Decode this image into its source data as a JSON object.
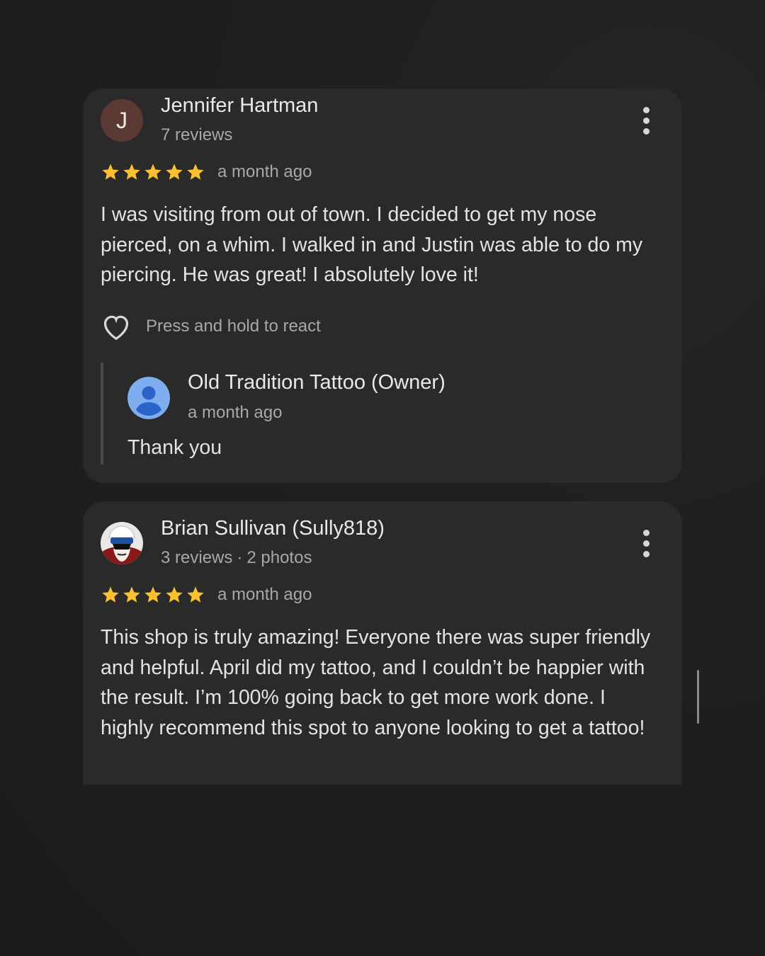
{
  "reviews": [
    {
      "author": "Jennifer Hartman",
      "avatar_letter": "J",
      "stats": "7 reviews",
      "rating": 5,
      "time": "a month ago",
      "text": "I was visiting from out of town. I decided to get my nose pierced, on a whim. I walked in and Justin was able to do my piercing. He was great! I absolutely love it!",
      "react_label": "Press and hold to react",
      "owner_reply": {
        "name": "Old Tradition Tattoo (Owner)",
        "time": "a month ago",
        "text": "Thank you"
      }
    },
    {
      "author": "Brian Sullivan (Sully818)",
      "stats_reviews": "3 reviews",
      "stats_separator": "·",
      "stats_photos": "2 photos",
      "rating": 5,
      "time": "a month ago",
      "text": "This shop is truly amazing! Everyone there was super friendly and helpful. April did my tattoo, and I couldn’t be happier with the result. I’m 100% going back to get more work done. I highly recommend this spot to anyone looking to get a tattoo!"
    }
  ],
  "icons": {
    "star": "star-icon",
    "more": "more-vert-icon",
    "heart": "heart-outline-icon",
    "owner_avatar": "default-profile-icon"
  },
  "colors": {
    "star": "#fbc02d",
    "card_bg": "#2a2a2b",
    "page_bg": "#1e1e1e",
    "avatar_j_bg": "#5a3a32",
    "owner_avatar_bg": "#7eaef0"
  }
}
